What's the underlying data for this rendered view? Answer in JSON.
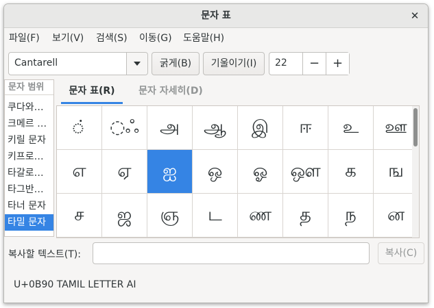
{
  "window": {
    "title": "문자 표"
  },
  "icons": {
    "close": "close-icon",
    "dropdown": "chevron-down-icon",
    "decrement": "minus-icon",
    "increment": "plus-icon"
  },
  "menu": [
    {
      "label": "파일(F)"
    },
    {
      "label": "보기(V)"
    },
    {
      "label": "검색(S)"
    },
    {
      "label": "이동(G)"
    },
    {
      "label": "도움말(H)"
    }
  ],
  "toolbar": {
    "font_name": "Cantarell",
    "bold_label": "굵게(B)",
    "italic_label": "기울이기(I)",
    "font_size": "22",
    "minus": "−",
    "plus": "+"
  },
  "categories": {
    "header": "문자 범위",
    "items": [
      {
        "label": "쿠다와…",
        "selected": false
      },
      {
        "label": "크메르 …",
        "selected": false
      },
      {
        "label": "키릴 문자",
        "selected": false
      },
      {
        "label": "키프로…",
        "selected": false
      },
      {
        "label": "타갈로…",
        "selected": false
      },
      {
        "label": "타그반…",
        "selected": false
      },
      {
        "label": "타너 문자",
        "selected": false
      },
      {
        "label": "타밀 문자",
        "selected": true
      }
    ]
  },
  "tabs": [
    {
      "label": "문자 표(R)",
      "active": true
    },
    {
      "label": "문자 자세히(D)",
      "active": false
    }
  ],
  "grid": {
    "rows": [
      [
        "◌்",
        "◌ஃ",
        "அ",
        "ஆ",
        "இ",
        "ஈ",
        "உ",
        "ஊ"
      ],
      [
        "எ",
        "ஏ",
        "ஐ",
        "ஒ",
        "ஓ",
        "ஔ",
        "க",
        "ங"
      ],
      [
        "ச",
        "ஜ",
        "ஞ",
        "ட",
        "ண",
        "த",
        "ந",
        "ன"
      ]
    ],
    "selected": {
      "row": 1,
      "col": 2
    }
  },
  "copy": {
    "label": "복사할 텍스트(T):",
    "value": "",
    "button": "복사(C)"
  },
  "status": "U+0B90 TAMIL LETTER AI",
  "colors": {
    "accent": "#3584e4",
    "window_bg": "#f6f5f4"
  }
}
